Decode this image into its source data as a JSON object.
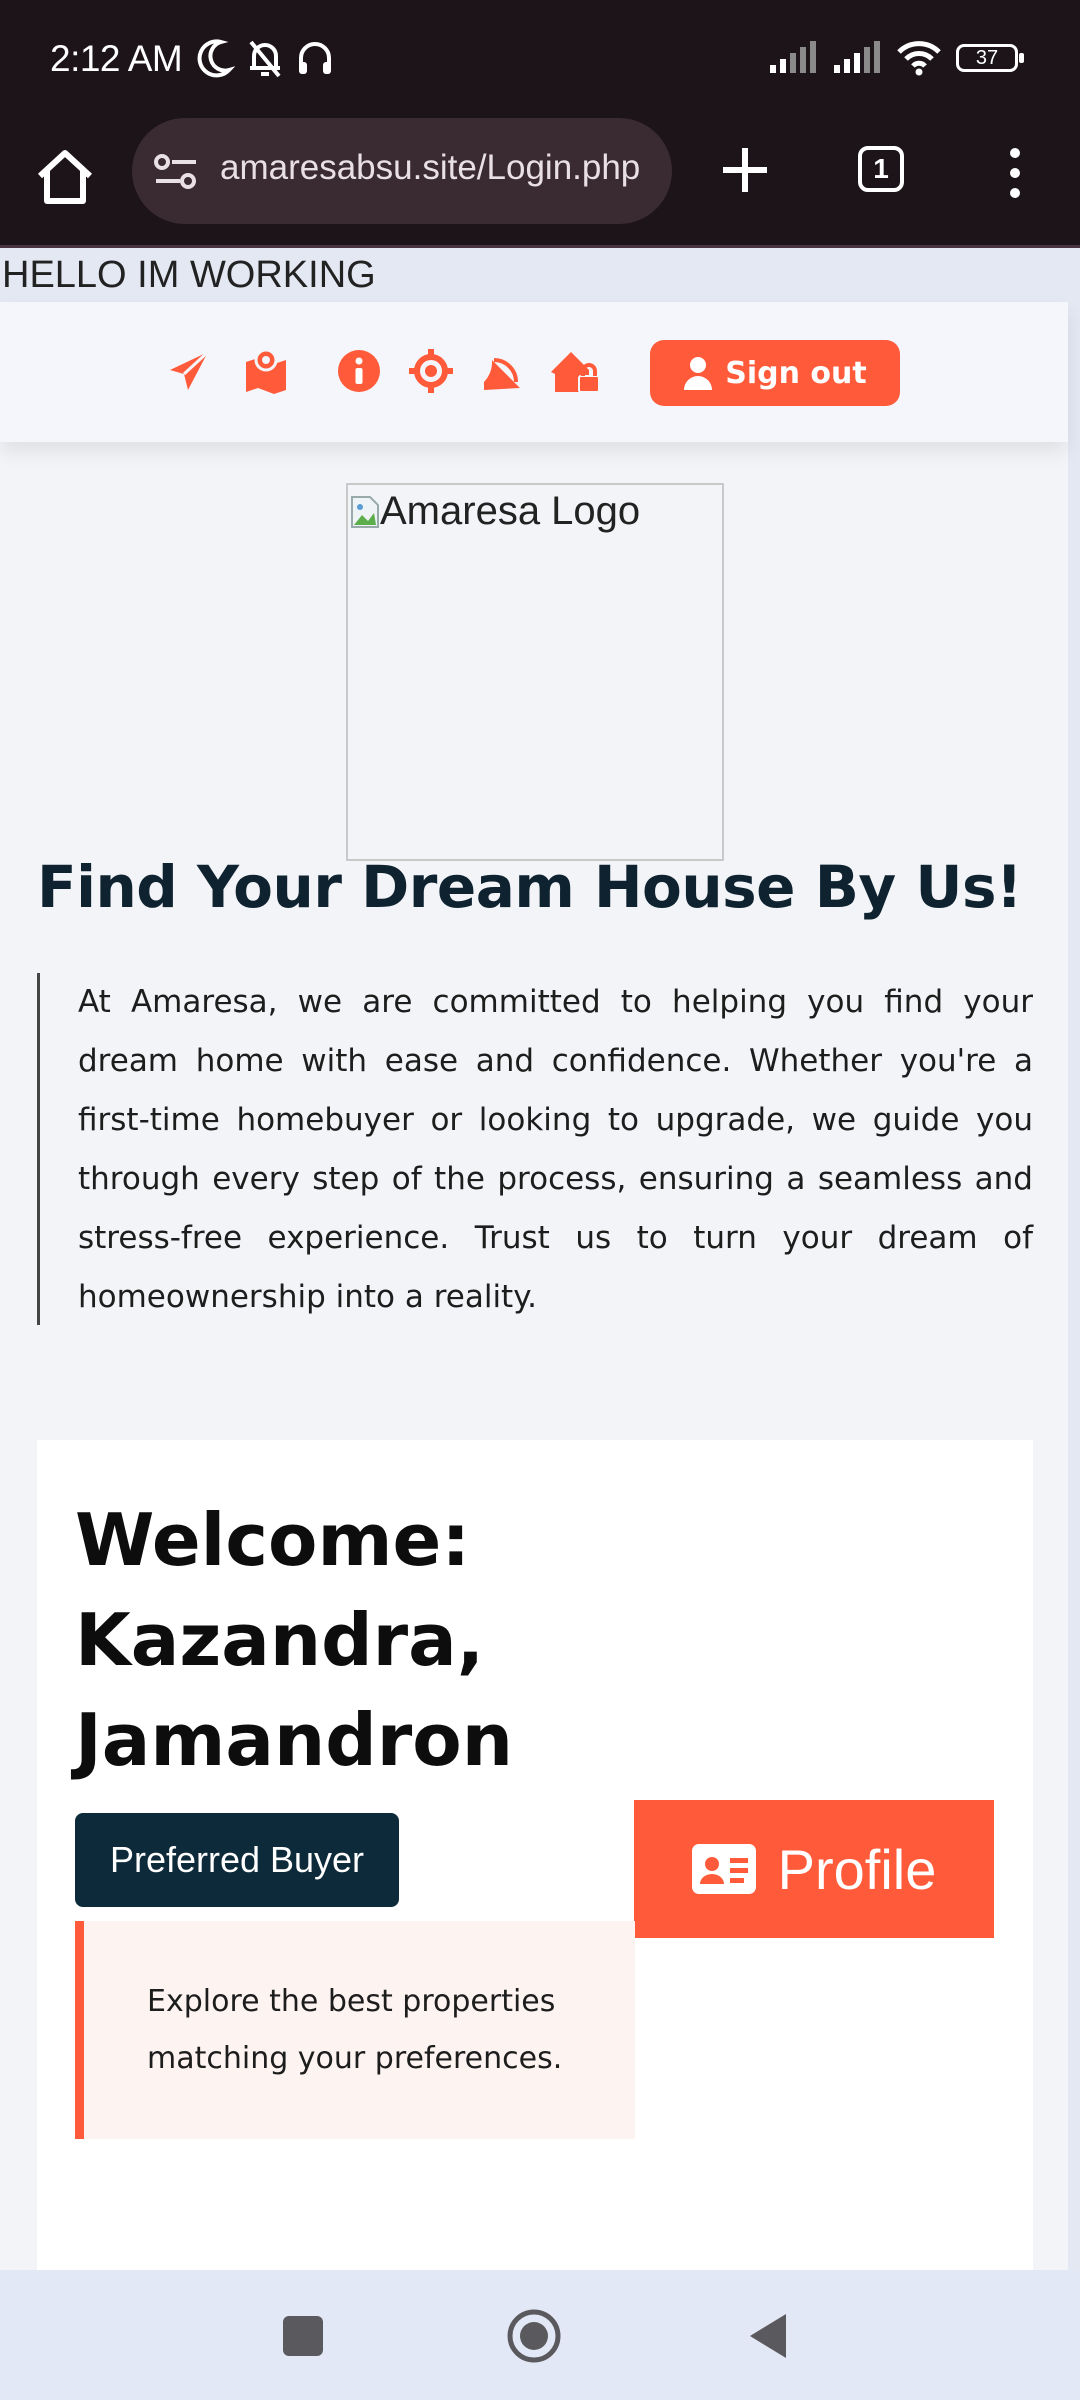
{
  "status_bar": {
    "time": "2:12 AM",
    "battery": "37",
    "left_icons": [
      "moon-icon",
      "bell-off-icon",
      "headphones-icon"
    ],
    "right_icons": [
      "signal-icon",
      "signal-icon",
      "wifi-icon",
      "battery-icon"
    ]
  },
  "browser": {
    "url": "amaresabsu.site/Login.php",
    "tab_count": "1"
  },
  "page": {
    "debug_text": "HELLO IM WORKING",
    "nav": {
      "icons": [
        "paper-plane-icon",
        "map-icon",
        "info-icon",
        "crosshair-icon",
        "satellite-dish-icon",
        "house-lock-icon"
      ],
      "signout_label": "Sign out"
    },
    "logo_alt": "Amaresa Logo",
    "hero": {
      "title": "Find Your Dream House By Us!",
      "text": "At Amaresa, we are committed to helping you find your dream home with ease and confidence. Whether you're a first-time homebuyer or looking to upgrade, we guide you through every step of the process, ensuring a seamless and stress-free experience. Trust us to turn your dream of homeownership into a reality."
    },
    "card": {
      "welcome": "Welcome: Kazandra, Jamandron",
      "badge": "Preferred Buyer",
      "profile_label": "Profile",
      "explore_text": "Explore the best properties matching your preferences."
    },
    "colors": {
      "accent": "#ff5b3a",
      "navy": "#0d2a3a",
      "heading": "#0e2230"
    }
  },
  "system_nav": [
    "recents-button",
    "home-button",
    "back-button"
  ]
}
